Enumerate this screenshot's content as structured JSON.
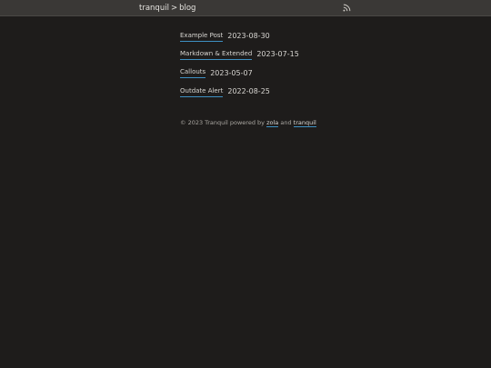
{
  "header": {
    "site": "tranquil",
    "separator": ">",
    "section": "blog",
    "rss_icon": "rss-icon"
  },
  "posts": [
    {
      "title": "Example Post",
      "date": "2023-08-30"
    },
    {
      "title": "Markdown & Extended",
      "date": "2023-07-15"
    },
    {
      "title": "Callouts",
      "date": "2023-05-07"
    },
    {
      "title": "Outdate Alert",
      "date": "2022-08-25"
    }
  ],
  "footer": {
    "prefix": "© 2023 Tranquil powered by",
    "link1": "zola",
    "and": "and",
    "link2": "tranquil"
  },
  "colors": {
    "background": "#1e1c1b",
    "topbar": "#3a3836",
    "link_underline": "#3e90c2"
  }
}
